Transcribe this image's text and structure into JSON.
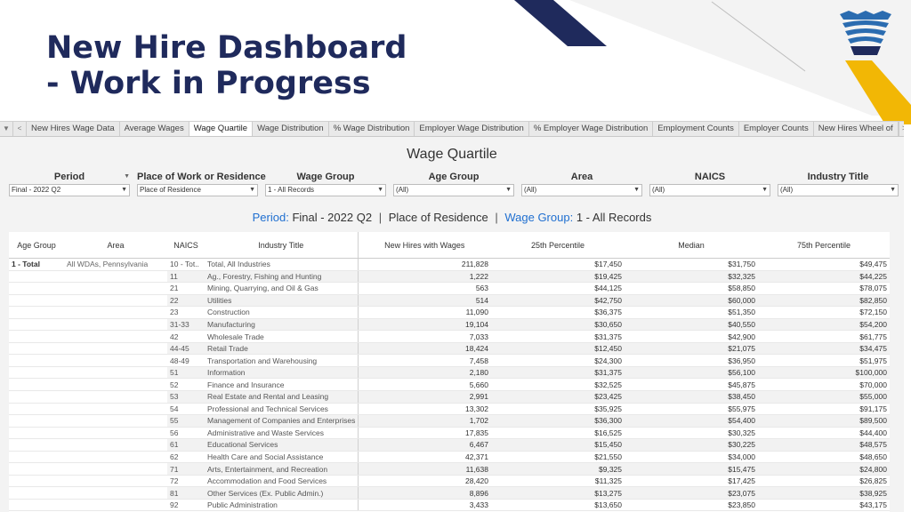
{
  "slide": {
    "title_line1": "New Hire Dashboard",
    "title_line2": "- Work in Progress"
  },
  "colors": {
    "navy": "#1f2a5c",
    "gold": "#f2b705",
    "accent_blue": "#1f6fd0"
  },
  "tabs": {
    "nav_icons": [
      "chevron-down-icon",
      "chevron-left-icon",
      "chevron-right-icon"
    ],
    "items": [
      {
        "label": "New Hires Wage Data"
      },
      {
        "label": "Average Wages"
      },
      {
        "label": "Wage Quartile"
      },
      {
        "label": "Wage Distribution"
      },
      {
        "label": "% Wage Distribution"
      },
      {
        "label": "Employer Wage Distribution"
      },
      {
        "label": "% Employer Wage Distribution"
      },
      {
        "label": "Employment Counts"
      },
      {
        "label": "Employer Counts"
      },
      {
        "label": "New Hires Wheel of"
      }
    ],
    "active": "Wage Quartile"
  },
  "dashboard": {
    "title": "Wage Quartile"
  },
  "filters": [
    {
      "label": "Period",
      "value": "Final - 2022 Q2"
    },
    {
      "label": "Place of Work or Residence",
      "value": "Place of Residence"
    },
    {
      "label": "Wage Group",
      "value": "1 - All Records"
    },
    {
      "label": "Age Group",
      "value": "(All)"
    },
    {
      "label": "Area",
      "value": "(All)"
    },
    {
      "label": "NAICS",
      "value": "(All)"
    },
    {
      "label": "Industry Title",
      "value": "(All)"
    }
  ],
  "subtitle": {
    "period_label": "Period:",
    "period_value": "Final - 2022 Q2",
    "place_value": "Place of Residence",
    "wage_label": "Wage Group:",
    "wage_value": "1 - All Records"
  },
  "table": {
    "columns": [
      "Age Group",
      "Area",
      "NAICS",
      "Industry Title",
      "New Hires with Wages",
      "25th Percentile",
      "Median",
      "75th Percentile"
    ],
    "age_group": "1 - Total",
    "area": "All WDAs, Pennsylvania",
    "rows": [
      {
        "naics": "10 - Tot..",
        "title": "Total, All Industries",
        "hires": "211,828",
        "p25": "$17,450",
        "median": "$31,750",
        "p75": "$49,475"
      },
      {
        "naics": "11",
        "title": "Ag., Forestry, Fishing and Hunting",
        "hires": "1,222",
        "p25": "$19,425",
        "median": "$32,325",
        "p75": "$44,225"
      },
      {
        "naics": "21",
        "title": "Mining, Quarrying, and Oil & Gas",
        "hires": "563",
        "p25": "$44,125",
        "median": "$58,850",
        "p75": "$78,075"
      },
      {
        "naics": "22",
        "title": "Utilities",
        "hires": "514",
        "p25": "$42,750",
        "median": "$60,000",
        "p75": "$82,850"
      },
      {
        "naics": "23",
        "title": "Construction",
        "hires": "11,090",
        "p25": "$36,375",
        "median": "$51,350",
        "p75": "$72,150"
      },
      {
        "naics": "31-33",
        "title": "Manufacturing",
        "hires": "19,104",
        "p25": "$30,650",
        "median": "$40,550",
        "p75": "$54,200"
      },
      {
        "naics": "42",
        "title": "Wholesale Trade",
        "hires": "7,033",
        "p25": "$31,375",
        "median": "$42,900",
        "p75": "$61,775"
      },
      {
        "naics": "44-45",
        "title": "Retail Trade",
        "hires": "18,424",
        "p25": "$12,450",
        "median": "$21,075",
        "p75": "$34,475"
      },
      {
        "naics": "48-49",
        "title": "Transportation and Warehousing",
        "hires": "7,458",
        "p25": "$24,300",
        "median": "$36,950",
        "p75": "$51,975"
      },
      {
        "naics": "51",
        "title": "Information",
        "hires": "2,180",
        "p25": "$31,375",
        "median": "$56,100",
        "p75": "$100,000"
      },
      {
        "naics": "52",
        "title": "Finance and Insurance",
        "hires": "5,660",
        "p25": "$32,525",
        "median": "$45,875",
        "p75": "$70,000"
      },
      {
        "naics": "53",
        "title": "Real Estate and Rental and Leasing",
        "hires": "2,991",
        "p25": "$23,425",
        "median": "$38,450",
        "p75": "$55,000"
      },
      {
        "naics": "54",
        "title": "Professional and Technical Services",
        "hires": "13,302",
        "p25": "$35,925",
        "median": "$55,975",
        "p75": "$91,175"
      },
      {
        "naics": "55",
        "title": "Management of Companies and Enterprises",
        "hires": "1,702",
        "p25": "$36,300",
        "median": "$54,400",
        "p75": "$89,500"
      },
      {
        "naics": "56",
        "title": "Administrative and Waste Services",
        "hires": "17,835",
        "p25": "$16,525",
        "median": "$30,325",
        "p75": "$44,400"
      },
      {
        "naics": "61",
        "title": "Educational Services",
        "hires": "6,467",
        "p25": "$15,450",
        "median": "$30,225",
        "p75": "$48,575"
      },
      {
        "naics": "62",
        "title": "Health Care and Social Assistance",
        "hires": "42,371",
        "p25": "$21,550",
        "median": "$34,000",
        "p75": "$48,650"
      },
      {
        "naics": "71",
        "title": "Arts, Entertainment, and Recreation",
        "hires": "11,638",
        "p25": "$9,325",
        "median": "$15,475",
        "p75": "$24,800"
      },
      {
        "naics": "72",
        "title": "Accommodation and Food Services",
        "hires": "28,420",
        "p25": "$11,325",
        "median": "$17,425",
        "p75": "$26,825"
      },
      {
        "naics": "81",
        "title": "Other Services (Ex. Public Admin.)",
        "hires": "8,896",
        "p25": "$13,275",
        "median": "$23,075",
        "p75": "$38,925"
      },
      {
        "naics": "92",
        "title": "Public Administration",
        "hires": "3,433",
        "p25": "$13,650",
        "median": "$23,850",
        "p75": "$43,175"
      }
    ]
  }
}
